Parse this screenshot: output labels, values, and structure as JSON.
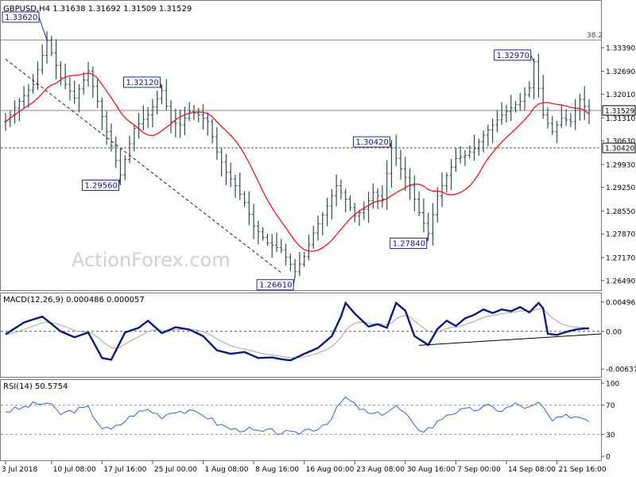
{
  "chart_data": [
    {
      "panel": "price",
      "type": "ohlc",
      "title": "GBPUSD,H4  1.31638 1.31692 1.31509 1.31529",
      "watermark": "ActionForex.com",
      "y_ticks": [
        "1.33390",
        "1.32690",
        "1.32010",
        "1.31310",
        "1.30630",
        "1.29930",
        "1.29250",
        "1.28550",
        "1.27870",
        "1.27170",
        "1.26490"
      ],
      "ylim": [
        1.2625,
        1.3445
      ],
      "current_price": "1.31529",
      "horizontal_levels": [
        {
          "label": "38.2",
          "value": 1.3362,
          "style": "solid"
        },
        {
          "label": "1.31529",
          "value": 1.31529,
          "style": "solid"
        },
        {
          "label": "1.30420",
          "value": 1.3042,
          "style": "dashed"
        }
      ],
      "annotations": [
        {
          "text": "1.33620",
          "bar": 9,
          "value": 1.3362
        },
        {
          "text": "1.29560",
          "bar": 25,
          "value": 1.2956
        },
        {
          "text": "1.32120",
          "bar": 34,
          "value": 1.3212
        },
        {
          "text": "1.26610",
          "bar": 63,
          "value": 1.2661
        },
        {
          "text": "1.30420",
          "bar": 84,
          "value": 1.3042
        },
        {
          "text": "1.27840",
          "bar": 92,
          "value": 1.2784
        },
        {
          "text": "1.32970",
          "bar": 115,
          "value": 1.3297
        }
      ],
      "trendline": {
        "from": {
          "bar": 0,
          "value": 1.3305
        },
        "to": {
          "bar": 60,
          "value": 1.2672
        }
      },
      "ma_color": "#e2181f",
      "bar_color": "#2f4f4f"
    },
    {
      "panel": "macd",
      "title": "MACD(12,26,9) 0.000486 0.000057",
      "y_ticks": [
        "0.004968",
        "0.00",
        "-0.006372"
      ],
      "ylim": [
        -0.00715,
        0.00575
      ],
      "series": [
        {
          "name": "MACD",
          "color": "#0b1c7a"
        },
        {
          "name": "Signal",
          "color": "#b4a0a0"
        }
      ],
      "trendline": {
        "from": {
          "bar": 90,
          "value": -0.00236
        },
        "to": {
          "bar": 126,
          "value": -0.00063
        }
      }
    },
    {
      "panel": "rsi",
      "title": "RSI(14) 50.5754",
      "y_ticks": [
        "100",
        "70",
        "30",
        "0"
      ],
      "ylim": [
        0,
        100
      ],
      "levels": [
        70,
        30
      ],
      "series": [
        {
          "name": "RSI",
          "color": "#3a63c8"
        }
      ]
    }
  ],
  "x_ticks": [
    {
      "label": "3 Jul 2018",
      "bar": 0
    },
    {
      "label": "10 Jul 08:00",
      "bar": 10
    },
    {
      "label": "17 Jul 16:00",
      "bar": 21
    },
    {
      "label": "25 Jul 00:00",
      "bar": 32
    },
    {
      "label": "1 Aug 08:00",
      "bar": 43
    },
    {
      "label": "8 Aug 16:00",
      "bar": 54
    },
    {
      "label": "16 Aug 00:00",
      "bar": 65
    },
    {
      "label": "23 Aug 08:00",
      "bar": 76
    },
    {
      "label": "30 Aug 16:00",
      "bar": 87
    },
    {
      "label": "7 Sep 00:00",
      "bar": 98
    },
    {
      "label": "14 Sep 08:00",
      "bar": 109
    },
    {
      "label": "21 Sep 16:00",
      "bar": 120
    }
  ],
  "price_anchors": [
    [
      0,
      1.312
    ],
    [
      3,
      1.318
    ],
    [
      6,
      1.323
    ],
    [
      9,
      1.336
    ],
    [
      12,
      1.325
    ],
    [
      15,
      1.319
    ],
    [
      18,
      1.327
    ],
    [
      20,
      1.318
    ],
    [
      22,
      1.309
    ],
    [
      25,
      1.2962
    ],
    [
      28,
      1.31
    ],
    [
      31,
      1.314
    ],
    [
      34,
      1.3212
    ],
    [
      36,
      1.312
    ],
    [
      38,
      1.311
    ],
    [
      40,
      1.315
    ],
    [
      42,
      1.314
    ],
    [
      44,
      1.312
    ],
    [
      46,
      1.303
    ],
    [
      48,
      1.297
    ],
    [
      50,
      1.293
    ],
    [
      52,
      1.288
    ],
    [
      54,
      1.281
    ],
    [
      57,
      1.276
    ],
    [
      60,
      1.274
    ],
    [
      63,
      1.2675
    ],
    [
      65,
      1.272
    ],
    [
      67,
      1.279
    ],
    [
      70,
      1.287
    ],
    [
      72,
      1.293
    ],
    [
      74,
      1.289
    ],
    [
      76,
      1.284
    ],
    [
      78,
      1.286
    ],
    [
      80,
      1.291
    ],
    [
      82,
      1.289
    ],
    [
      84,
      1.3042
    ],
    [
      86,
      1.298
    ],
    [
      88,
      1.293
    ],
    [
      90,
      1.285
    ],
    [
      92,
      1.2788
    ],
    [
      94,
      1.29
    ],
    [
      96,
      1.296
    ],
    [
      98,
      1.301
    ],
    [
      100,
      1.302
    ],
    [
      102,
      1.304
    ],
    [
      104,
      1.308
    ],
    [
      106,
      1.311
    ],
    [
      108,
      1.314
    ],
    [
      110,
      1.316
    ],
    [
      112,
      1.318
    ],
    [
      114,
      1.322
    ],
    [
      115,
      1.3297
    ],
    [
      117,
      1.314
    ],
    [
      119,
      1.309
    ],
    [
      121,
      1.313
    ],
    [
      123,
      1.312
    ],
    [
      125,
      1.3186
    ],
    [
      126,
      1.3165
    ],
    [
      127,
      1.31529
    ]
  ],
  "macd_anchors": [
    [
      0,
      -0.0005
    ],
    [
      4,
      0.0015
    ],
    [
      8,
      0.0025
    ],
    [
      12,
      0.0
    ],
    [
      15,
      -0.001
    ],
    [
      18,
      -0.0002
    ],
    [
      21,
      -0.0045
    ],
    [
      23,
      -0.0048
    ],
    [
      26,
      -0.0002
    ],
    [
      29,
      0.0006
    ],
    [
      31,
      0.0018
    ],
    [
      34,
      -0.0003
    ],
    [
      37,
      0.0007
    ],
    [
      40,
      0.0003
    ],
    [
      43,
      -0.0008
    ],
    [
      46,
      -0.0032
    ],
    [
      49,
      -0.0038
    ],
    [
      52,
      -0.0035
    ],
    [
      55,
      -0.0045
    ],
    [
      58,
      -0.0044
    ],
    [
      60,
      -0.0047
    ],
    [
      62,
      -0.0049
    ],
    [
      65,
      -0.0038
    ],
    [
      68,
      -0.0028
    ],
    [
      71,
      -0.0008
    ],
    [
      73,
      0.0025
    ],
    [
      74,
      0.0048
    ],
    [
      76,
      0.003
    ],
    [
      79,
      0.0008
    ],
    [
      81,
      0.0012
    ],
    [
      83,
      0.0006
    ],
    [
      85,
      0.0048
    ],
    [
      87,
      0.0035
    ],
    [
      89,
      -0.0008
    ],
    [
      92,
      -0.0023
    ],
    [
      94,
      0.0004
    ],
    [
      96,
      0.0018
    ],
    [
      98,
      0.0009
    ],
    [
      100,
      0.0022
    ],
    [
      102,
      0.0028
    ],
    [
      104,
      0.0037
    ],
    [
      106,
      0.0031
    ],
    [
      108,
      0.0037
    ],
    [
      110,
      0.0034
    ],
    [
      112,
      0.0041
    ],
    [
      114,
      0.0032
    ],
    [
      116,
      0.0048
    ],
    [
      117,
      0.0039
    ],
    [
      118,
      -0.0004
    ],
    [
      120,
      -0.0006
    ],
    [
      122,
      -0.0001
    ],
    [
      124,
      0.0003
    ],
    [
      126,
      0.00049
    ]
  ],
  "rsi_anchors": [
    [
      0,
      62
    ],
    [
      3,
      65
    ],
    [
      6,
      71
    ],
    [
      9,
      73
    ],
    [
      12,
      58
    ],
    [
      15,
      63
    ],
    [
      18,
      66
    ],
    [
      21,
      39
    ],
    [
      23,
      36
    ],
    [
      25,
      44
    ],
    [
      28,
      58
    ],
    [
      31,
      64
    ],
    [
      34,
      55
    ],
    [
      37,
      63
    ],
    [
      40,
      60
    ],
    [
      43,
      58
    ],
    [
      46,
      45
    ],
    [
      48,
      40
    ],
    [
      50,
      36
    ],
    [
      52,
      38
    ],
    [
      55,
      33
    ],
    [
      58,
      34
    ],
    [
      61,
      32
    ],
    [
      63,
      30
    ],
    [
      65,
      36
    ],
    [
      68,
      39
    ],
    [
      71,
      52
    ],
    [
      73,
      74
    ],
    [
      74,
      80
    ],
    [
      76,
      70
    ],
    [
      79,
      58
    ],
    [
      81,
      57
    ],
    [
      83,
      62
    ],
    [
      85,
      68
    ],
    [
      87,
      58
    ],
    [
      89,
      40
    ],
    [
      91,
      36
    ],
    [
      93,
      41
    ],
    [
      96,
      58
    ],
    [
      99,
      62
    ],
    [
      102,
      64
    ],
    [
      105,
      68
    ],
    [
      108,
      63
    ],
    [
      111,
      71
    ],
    [
      114,
      66
    ],
    [
      116,
      72
    ],
    [
      117,
      66
    ],
    [
      119,
      48
    ],
    [
      121,
      52
    ],
    [
      123,
      56
    ],
    [
      125,
      54
    ],
    [
      127,
      51
    ]
  ]
}
